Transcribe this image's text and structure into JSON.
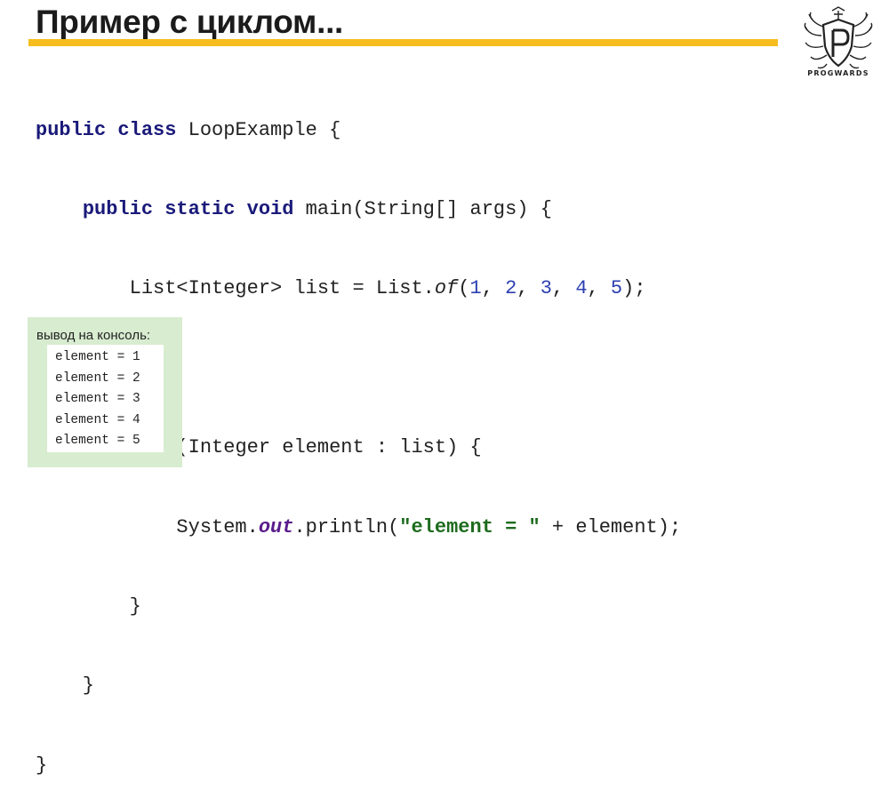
{
  "slide": {
    "title": "Пример с циклом...",
    "accent_color": "#f5be1e"
  },
  "logo": {
    "text": "PROGWARDS",
    "icon": "progwards-crest-icon"
  },
  "code": {
    "language": "java",
    "lines": [
      "public class LoopExample {",
      "    public static void main(String[] args) {",
      "        List<Integer> list = List.of(1, 2, 3, 4, 5);",
      "",
      "        for (Integer element : list) {",
      "            System.out.println(\"element = \" + element);",
      "        }",
      "    }",
      "}"
    ]
  },
  "console": {
    "label": "вывод на консоль:",
    "output": [
      "element = 1",
      "element = 2",
      "element = 3",
      "element = 4",
      "element = 5"
    ],
    "background": "#d8ecd0"
  }
}
